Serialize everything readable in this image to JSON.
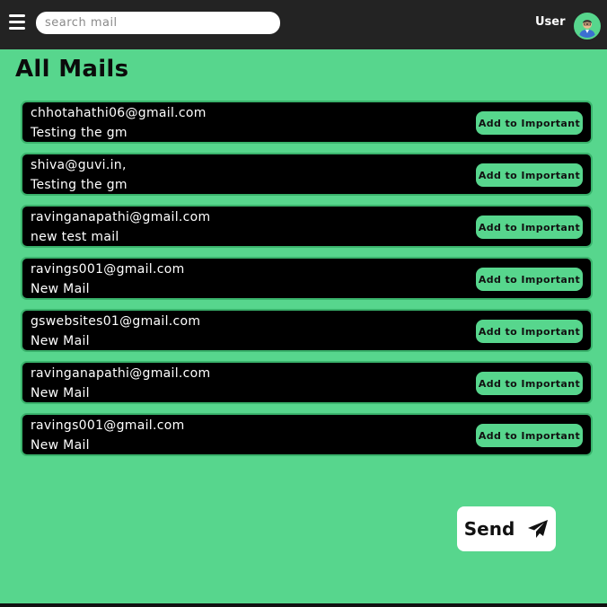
{
  "topbar": {
    "menu_icon": "hamburger-menu-icon",
    "search_placeholder": "search mail",
    "user_label": "User",
    "avatar_icon": "user-avatar-icon"
  },
  "main": {
    "title": "All Mails",
    "mails": [
      {
        "from": "chhotahathi06@gmail.com",
        "subject": "Testing the gm",
        "action_label": "Add to Important"
      },
      {
        "from": "shiva@guvi.in,",
        "subject": "Testing the gm",
        "action_label": "Add to Important"
      },
      {
        "from": "ravinganapathi@gmail.com",
        "subject": "new test mail",
        "action_label": "Add to Important"
      },
      {
        "from": "ravings001@gmail.com",
        "subject": "New Mail",
        "action_label": "Add to Important"
      },
      {
        "from": "gswebsites01@gmail.com",
        "subject": "New Mail",
        "action_label": "Add to Important"
      },
      {
        "from": "ravinganapathi@gmail.com",
        "subject": "New Mail",
        "action_label": "Add to Important"
      },
      {
        "from": "ravings001@gmail.com",
        "subject": "New Mail",
        "action_label": "Add to Important"
      }
    ]
  },
  "send": {
    "label": "Send",
    "icon": "paper-plane-icon"
  },
  "colors": {
    "background": "#57d68d",
    "topbar": "#232323",
    "mail_item": "#000000",
    "accent": "#57d68d"
  }
}
